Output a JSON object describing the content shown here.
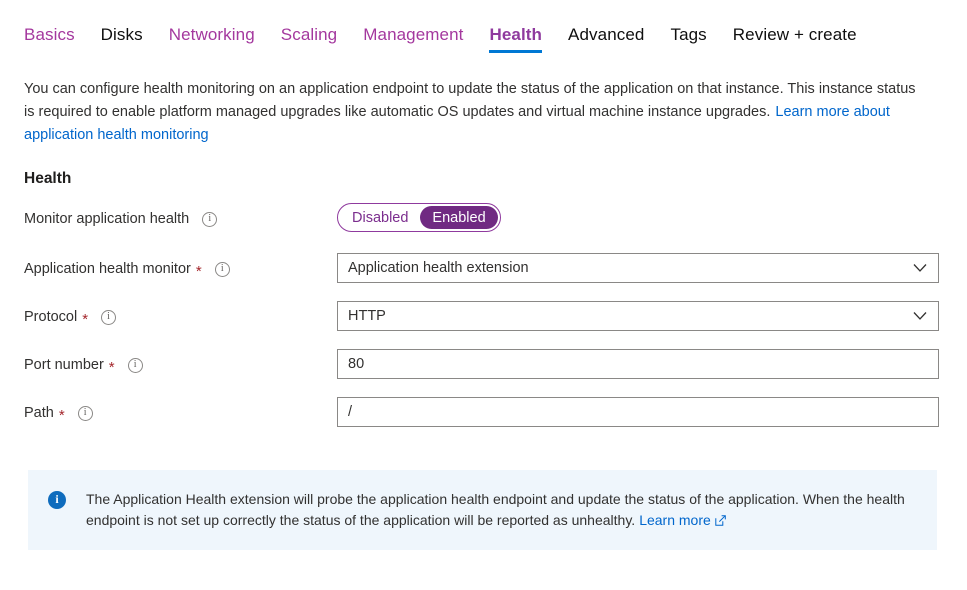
{
  "tabs": [
    {
      "label": "Basics",
      "state": "link"
    },
    {
      "label": "Disks",
      "state": "visited"
    },
    {
      "label": "Networking",
      "state": "link"
    },
    {
      "label": "Scaling",
      "state": "link"
    },
    {
      "label": "Management",
      "state": "link"
    },
    {
      "label": "Health",
      "state": "active"
    },
    {
      "label": "Advanced",
      "state": "visited"
    },
    {
      "label": "Tags",
      "state": "visited"
    },
    {
      "label": "Review + create",
      "state": "visited"
    }
  ],
  "intro": {
    "text": "You can configure health monitoring on an application endpoint to update the status of the application on that instance. This instance status is required to enable platform managed upgrades like automatic OS updates and virtual machine instance upgrades.",
    "link": "Learn more about application health monitoring"
  },
  "section": {
    "title": "Health"
  },
  "fields": {
    "monitor": {
      "label": "Monitor application health",
      "info_icon": "info-icon",
      "toggle": {
        "off_label": "Disabled",
        "on_label": "Enabled",
        "selected": "Enabled"
      }
    },
    "monitor_type": {
      "label": "Application health monitor",
      "required": "*",
      "info_icon": "info-icon",
      "value": "Application health extension",
      "chevron_icon": "chevron-down-icon"
    },
    "protocol": {
      "label": "Protocol",
      "required": "*",
      "info_icon": "info-icon",
      "value": "HTTP",
      "chevron_icon": "chevron-down-icon"
    },
    "port": {
      "label": "Port number",
      "required": "*",
      "info_icon": "info-icon",
      "value": "80"
    },
    "path": {
      "label": "Path",
      "required": "*",
      "info_icon": "info-icon",
      "value": "/"
    }
  },
  "banner": {
    "icon": "info-circle-icon",
    "message": "The Application Health extension will probe the application health endpoint and update the status of the application. When the health endpoint is not set up correctly the status of the application will be reported as unhealthy.",
    "link": "Learn more",
    "link_icon": "external-link-icon"
  },
  "colors": {
    "accent_purple": "#8f3a9e",
    "toggle_purple": "#702a82",
    "active_underline": "#0078d4",
    "link_blue": "#0066cc",
    "required_red": "#a4262c",
    "banner_bg": "#eff6fc",
    "banner_icon": "#0f6cbd"
  }
}
